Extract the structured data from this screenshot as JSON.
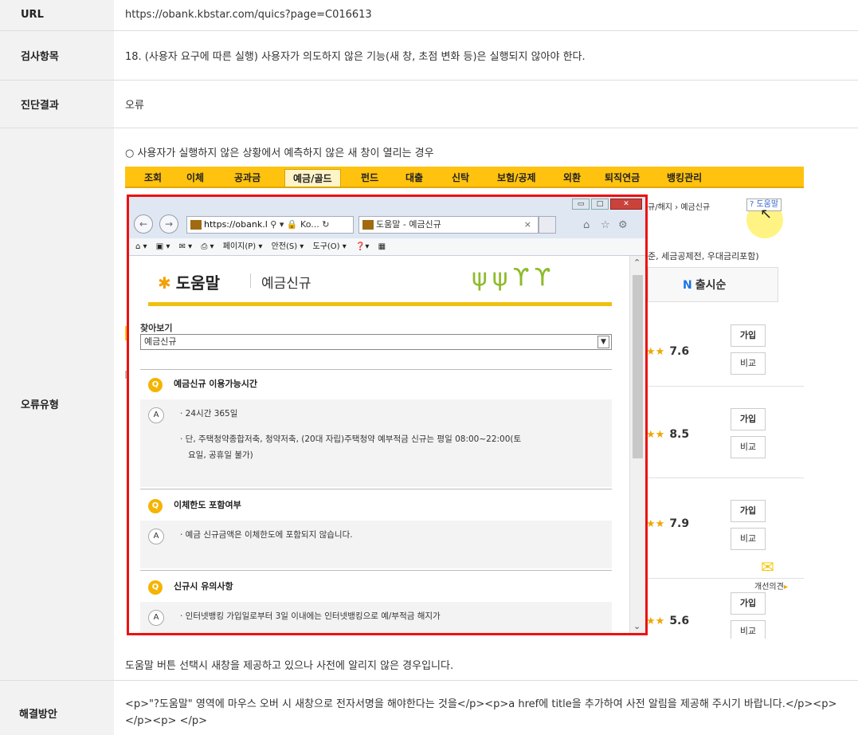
{
  "labels": {
    "url": "URL",
    "item": "검사항목",
    "result": "진단결과",
    "type": "오류유형",
    "fix": "해결방안"
  },
  "values": {
    "url": "https://obank.kbstar.com/quics?page=C016613",
    "item": "18. (사용자 요구에 따른 실행) 사용자가 의도하지 않은 기능(새 창, 초점 변화 등)은 실행되지 않아야 한다.",
    "result": "오류",
    "type_desc": "○ 사용자가 실행하지 않은 상황에서 예측하지 않은 새 창이 열리는 경우",
    "type_foot": "도움말 버튼 선택시 새창을 제공하고 있으나 사전에 알리지 않은 경우입니다.",
    "fix": "<p>\"?도움말\" 영역에 마우스 오버 시 새창으로 전자서명을 해야한다는 것을</p><p>a href에 title을 추가하여 사전 알림을 제공해 주시기 바랍니다.</p><p> </p><p> </p>"
  },
  "screenshot": {
    "nav": [
      "조회",
      "이체",
      "공과금",
      "예금/골드",
      "펀드",
      "대출",
      "신탁",
      "보험/공제",
      "외환",
      "퇴직연금",
      "뱅킹관리"
    ],
    "crumb": "규/해지 › 예금신규",
    "help_button": "? 도움말",
    "filter_text": "준, 세금공제전, 우대금리포함)",
    "sort_label": "출시순",
    "sort_mark": "N",
    "ratings": [
      "7.6",
      "8.5",
      "7.9",
      "5.6"
    ],
    "join_label": "가입",
    "compare_label": "비교",
    "opinion": "개선의견",
    "popup": {
      "url": "https://obank.l",
      "url_tail": "Ko...",
      "tab_title": "도움말 - 예금신규",
      "cmd_items": [
        "페이지(P) ▾",
        "안전(S) ▾",
        "도구(O) ▾"
      ],
      "logo_text": "도움말",
      "page_title": "예금신규",
      "find_label": "찾아보기",
      "find_value": "예금신규",
      "q_badge": "Q",
      "a_badge": "A",
      "qa": [
        {
          "q": "예금신규 이용가능시간",
          "a": [
            "· 24시간 365일",
            "· 단, 주택청약종합저축, 청약저축, (20대 자립)주택청약 예부적금 신규는 평일 08:00~22:00(토",
            "  요일, 공휴일 불가)"
          ]
        },
        {
          "q": "이체한도 포함여부",
          "a": [
            "· 예금 신규금액은 이체한도에 포함되지 않습니다."
          ]
        },
        {
          "q": "신규시 유의사항",
          "a": [
            "· 인터넷뱅킹 가입일로부터 3일 이내에는 인터넷뱅킹으로 예/부적금 해지가"
          ]
        }
      ]
    }
  }
}
